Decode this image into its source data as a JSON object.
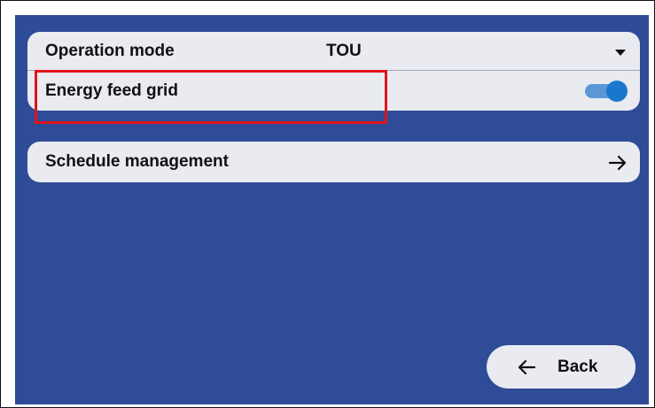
{
  "settings": {
    "operation_mode": {
      "label": "Operation mode",
      "value": "TOU",
      "icon": "chevron-down-icon"
    },
    "energy_feed_grid": {
      "label": "Energy feed grid",
      "enabled": true,
      "icon": "toggle-switch"
    }
  },
  "schedule": {
    "label": "Schedule management",
    "icon": "arrow-right-icon"
  },
  "back": {
    "label": "Back",
    "icon": "arrow-left-icon"
  },
  "colors": {
    "background": "#2e4c97",
    "card": "#e9ebf1",
    "toggle_on": "#1978cc",
    "highlight": "#e0141b"
  }
}
